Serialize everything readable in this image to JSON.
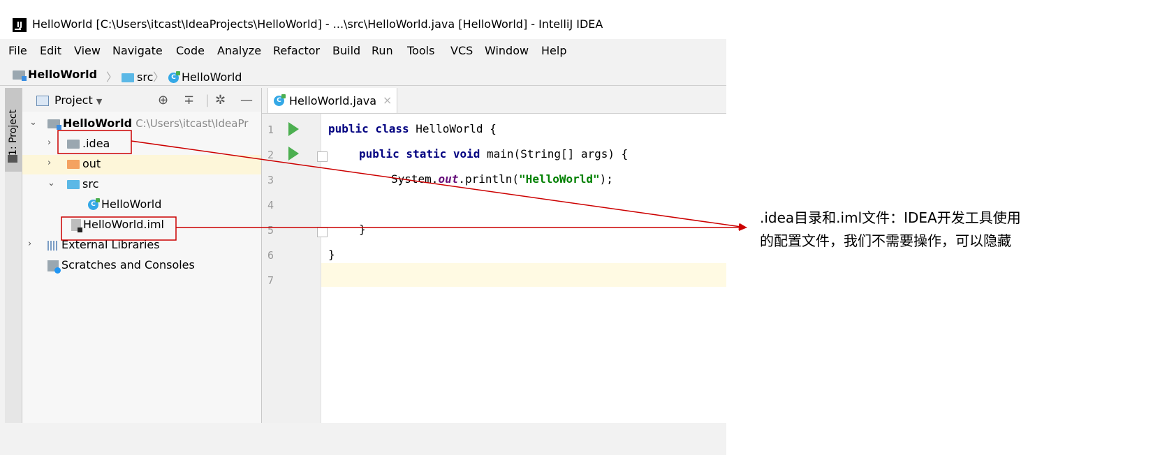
{
  "window": {
    "title": "HelloWorld [C:\\Users\\itcast\\IdeaProjects\\HelloWorld] - ...\\src\\HelloWorld.java [HelloWorld] - IntelliJ IDEA"
  },
  "menu": [
    "File",
    "Edit",
    "View",
    "Navigate",
    "Code",
    "Analyze",
    "Refactor",
    "Build",
    "Run",
    "Tools",
    "VCS",
    "Window",
    "Help"
  ],
  "breadcrumb": [
    "HelloWorld",
    "src",
    "HelloWorld"
  ],
  "sidebar": {
    "tab_label": "1: Project"
  },
  "project_panel": {
    "title": "Project",
    "tree": [
      {
        "label": "HelloWorld",
        "path": "C:\\Users\\itcast\\IdeaPr"
      },
      {
        "label": ".idea"
      },
      {
        "label": "out"
      },
      {
        "label": "src"
      },
      {
        "label": "HelloWorld"
      },
      {
        "label": "HelloWorld.iml"
      },
      {
        "label": "External Libraries"
      },
      {
        "label": "Scratches and Consoles"
      }
    ]
  },
  "editor": {
    "tab_label": "HelloWorld.java",
    "line_numbers": [
      "1",
      "2",
      "3",
      "4",
      "5",
      "6",
      "7"
    ],
    "code": {
      "l1_kw": "public class",
      "l1_rest": " HelloWorld {",
      "l2_kw": "public static void",
      "l2_rest": " main(String[] args) {",
      "l3_a": "System.",
      "l3_field": "out",
      "l3_b": ".println(",
      "l3_str": "\"HelloWorld\"",
      "l3_c": ");",
      "l5": "}",
      "l6": "}"
    }
  },
  "annotation": {
    "line1": ".idea目录和.iml文件：IDEA开发工具使用",
    "line2": "的配置文件，我们不需要操作，可以隐藏"
  },
  "colors": {
    "annotation": "#cc0000",
    "run_icon": "#4caf50",
    "keyword": "#000080",
    "string": "#008000"
  }
}
